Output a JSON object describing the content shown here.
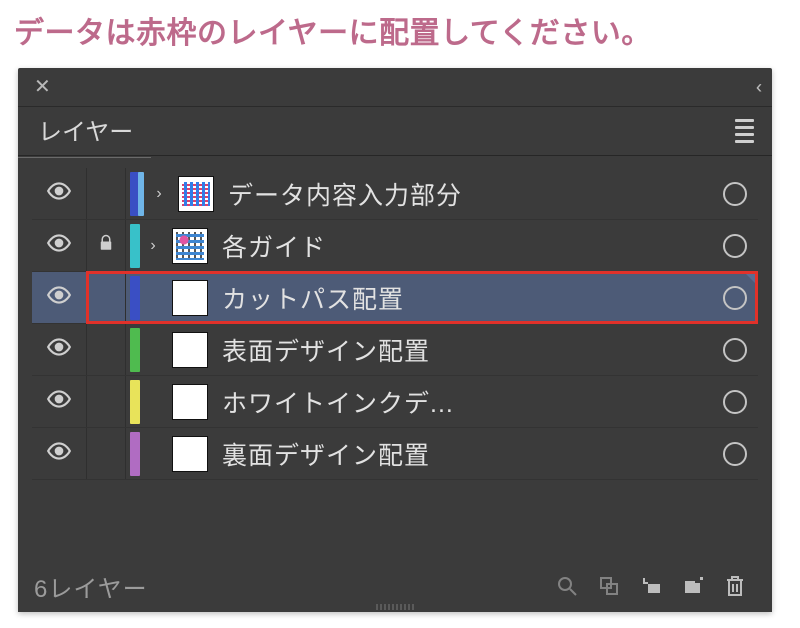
{
  "instruction": "データは赤枠のレイヤーに配置してください。",
  "panel": {
    "tab_title": "レイヤー",
    "footer_count": "6レイヤー"
  },
  "layers": [
    {
      "name": "データ内容入力部分",
      "color": "#3a4fc4",
      "secondary_color": "#6fb5e8",
      "locked": false,
      "expandable": true,
      "thumb": "art1",
      "selected": false,
      "highlighted": false
    },
    {
      "name": "各ガイド",
      "color": "#38c1c9",
      "secondary_color": null,
      "locked": true,
      "expandable": true,
      "thumb": "art2",
      "selected": false,
      "highlighted": false
    },
    {
      "name": "カットパス配置",
      "color": "#3a4fc4",
      "secondary_color": null,
      "locked": false,
      "expandable": false,
      "thumb": "blank",
      "selected": true,
      "highlighted": true
    },
    {
      "name": "表面デザイン配置",
      "color": "#4fbb4f",
      "secondary_color": null,
      "locked": false,
      "expandable": false,
      "thumb": "blank",
      "selected": false,
      "highlighted": false
    },
    {
      "name": "ホワイトインクデ...",
      "color": "#e8e35a",
      "secondary_color": null,
      "locked": false,
      "expandable": false,
      "thumb": "blank",
      "selected": false,
      "highlighted": false
    },
    {
      "name": "裏面デザイン配置",
      "color": "#b06cc2",
      "secondary_color": null,
      "locked": false,
      "expandable": false,
      "thumb": "blank",
      "selected": false,
      "highlighted": false
    }
  ]
}
